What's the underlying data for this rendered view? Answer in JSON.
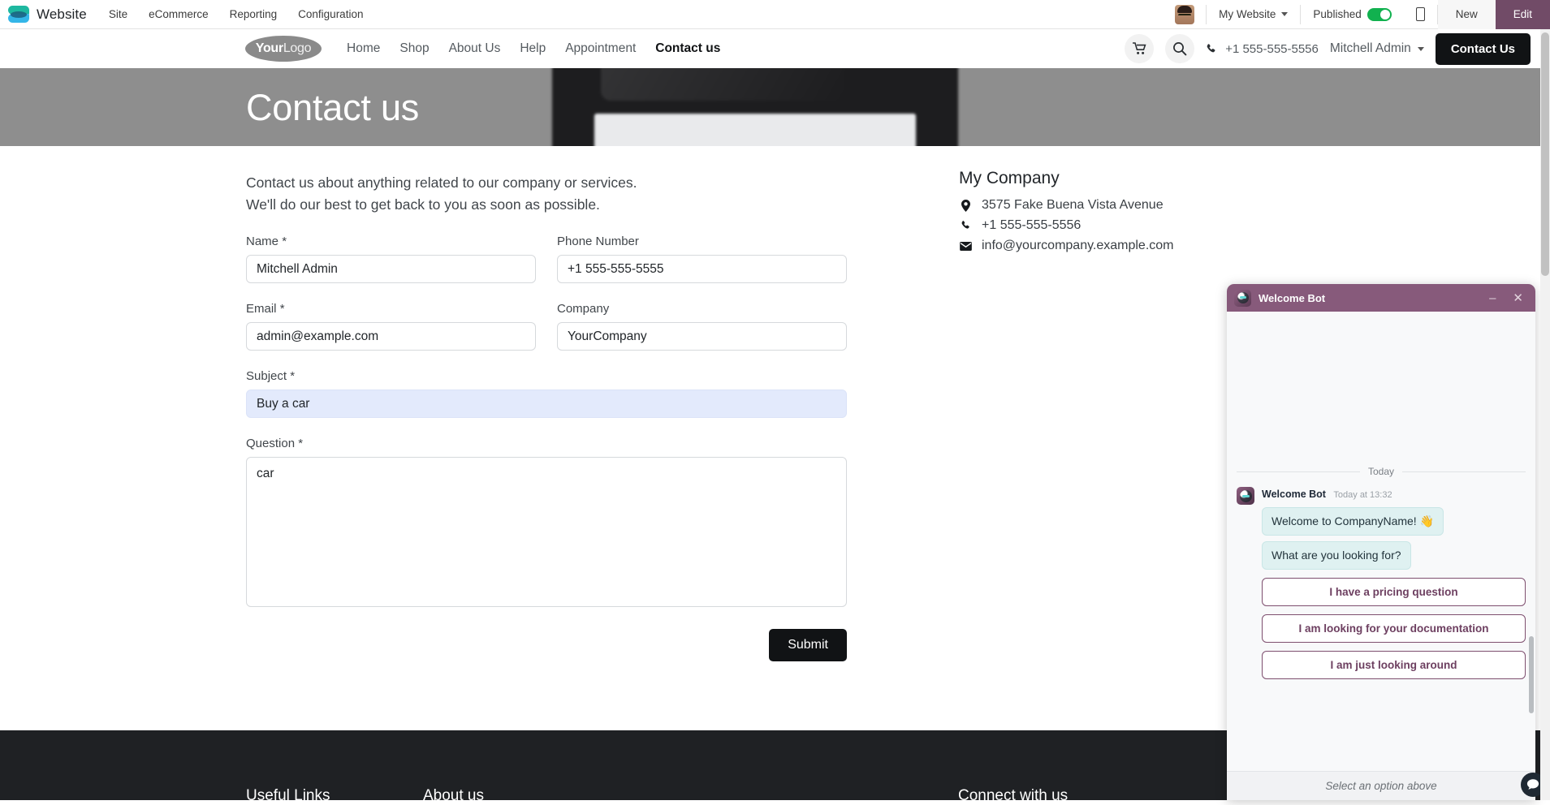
{
  "odoo_bar": {
    "app_name": "Website",
    "menus": [
      "Site",
      "eCommerce",
      "Reporting",
      "Configuration"
    ],
    "website_selector": "My Website",
    "published_label": "Published",
    "published_state": "on",
    "new_label": "New",
    "edit_label": "Edit",
    "accent_color": "#714b67"
  },
  "site_header": {
    "logo_bold": "Your",
    "logo_light": "Logo",
    "nav": [
      {
        "label": "Home",
        "active": false
      },
      {
        "label": "Shop",
        "active": false
      },
      {
        "label": "About Us",
        "active": false
      },
      {
        "label": "Help",
        "active": false
      },
      {
        "label": "Appointment",
        "active": false
      },
      {
        "label": "Contact us",
        "active": true
      }
    ],
    "phone": "+1 555-555-5556",
    "user": "Mitchell Admin",
    "cta_label": "Contact Us"
  },
  "hero": {
    "title": "Contact us"
  },
  "form": {
    "intro_line_1": "Contact us about anything related to our company or services.",
    "intro_line_2": "We'll do our best to get back to you as soon as possible.",
    "name_label": "Name",
    "name_value": "Mitchell Admin",
    "phone_label": "Phone Number",
    "phone_value": "+1 555-555-5555",
    "email_label": "Email",
    "email_value": "admin@example.com",
    "company_label": "Company",
    "company_value": "YourCompany",
    "subject_label": "Subject",
    "subject_value": "Buy a car",
    "question_label": "Question",
    "question_value": "car",
    "required_marker": "*",
    "submit_label": "Submit"
  },
  "company_info": {
    "title": "My Company",
    "address": "3575 Fake Buena Vista Avenue",
    "phone": "+1 555-555-5556",
    "email": "info@yourcompany.example.com"
  },
  "footer": {
    "col_1": "Useful Links",
    "col_2": "About us",
    "col_3": "Connect with us"
  },
  "chat": {
    "title": "Welcome Bot",
    "minimize_glyph": "–",
    "close_glyph": "✕",
    "day_divider": "Today",
    "author": "Welcome Bot",
    "timestamp": "Today at 13:32",
    "messages": [
      "Welcome to CompanyName! 👋",
      "What are you looking for?"
    ],
    "options": [
      "I have a pricing question",
      "I am looking for your documentation",
      "I am just looking around"
    ],
    "footer_hint": "Select an option above",
    "header_color": "#875a7b"
  }
}
